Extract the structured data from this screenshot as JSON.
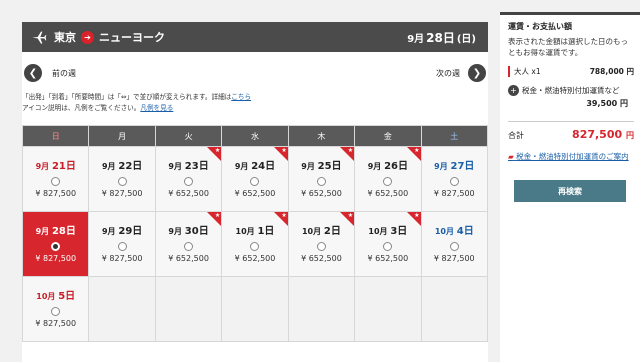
{
  "route": {
    "from": "東京",
    "arrow": "➔",
    "to": "ニューヨーク",
    "date_prefix": "9月",
    "date_day": "28日",
    "weekday": "(日)"
  },
  "nav": {
    "prev_label": "前の週",
    "next_label": "次の週",
    "prev_icon": "chevron-left",
    "next_icon": "chevron-right"
  },
  "note": {
    "line1": "「出発」「到着」「所要時間」は「⇔」で並び順が変えられます。詳細は",
    "line1_link": "こちら",
    "line2": "アイコン説明は、凡例をご覧ください。",
    "line2_link": "凡例を見る"
  },
  "calendar": {
    "headers": [
      "日",
      "月",
      "火",
      "水",
      "木",
      "金",
      "土"
    ],
    "rows": [
      [
        {
          "month": "9月",
          "day": "21日",
          "price": "¥ 827,500",
          "color": "red",
          "star": false,
          "selected": false
        },
        {
          "month": "9月",
          "day": "22日",
          "price": "¥ 827,500",
          "color": "",
          "star": false,
          "selected": false
        },
        {
          "month": "9月",
          "day": "23日",
          "price": "¥ 652,500",
          "color": "",
          "star": true,
          "selected": false
        },
        {
          "month": "9月",
          "day": "24日",
          "price": "¥ 652,500",
          "color": "",
          "star": true,
          "selected": false
        },
        {
          "month": "9月",
          "day": "25日",
          "price": "¥ 652,500",
          "color": "",
          "star": true,
          "selected": false
        },
        {
          "month": "9月",
          "day": "26日",
          "price": "¥ 652,500",
          "color": "",
          "star": true,
          "selected": false
        },
        {
          "month": "9月",
          "day": "27日",
          "price": "¥ 827,500",
          "color": "blue",
          "star": false,
          "selected": false
        }
      ],
      [
        {
          "month": "9月",
          "day": "28日",
          "price": "¥ 827,500",
          "color": "",
          "star": false,
          "selected": true
        },
        {
          "month": "9月",
          "day": "29日",
          "price": "¥ 827,500",
          "color": "",
          "star": false,
          "selected": false
        },
        {
          "month": "9月",
          "day": "30日",
          "price": "¥ 652,500",
          "color": "",
          "star": true,
          "selected": false
        },
        {
          "month": "10月",
          "day": "1日",
          "price": "¥ 652,500",
          "color": "",
          "star": true,
          "selected": false
        },
        {
          "month": "10月",
          "day": "2日",
          "price": "¥ 652,500",
          "color": "",
          "star": true,
          "selected": false
        },
        {
          "month": "10月",
          "day": "3日",
          "price": "¥ 652,500",
          "color": "",
          "star": true,
          "selected": false
        },
        {
          "month": "10月",
          "day": "4日",
          "price": "¥ 827,500",
          "color": "blue",
          "star": false,
          "selected": false
        }
      ],
      [
        {
          "month": "10月",
          "day": "5日",
          "price": "¥ 827,500",
          "color": "red",
          "star": false,
          "selected": false
        },
        null,
        null,
        null,
        null,
        null,
        null
      ]
    ]
  },
  "side": {
    "title": "運賃・お支払い額",
    "desc": "表示された金額は選択した日のもっともお得な運賃です。",
    "adult_label": "大人 x1",
    "adult_amount": "788,000 円",
    "tax_label": "税金・燃油特別付加運賃など",
    "tax_amount": "39,500 円",
    "total_label": "合計",
    "total_amount": "827,500",
    "total_unit": "円",
    "fuel_link": "税金・燃油特別付加運賃のご案内",
    "search_button": "再検索"
  },
  "colors": {
    "accent": "#d7262d",
    "header": "#4b4b4b",
    "button": "#4a7a87",
    "link": "#1a5ea8"
  }
}
